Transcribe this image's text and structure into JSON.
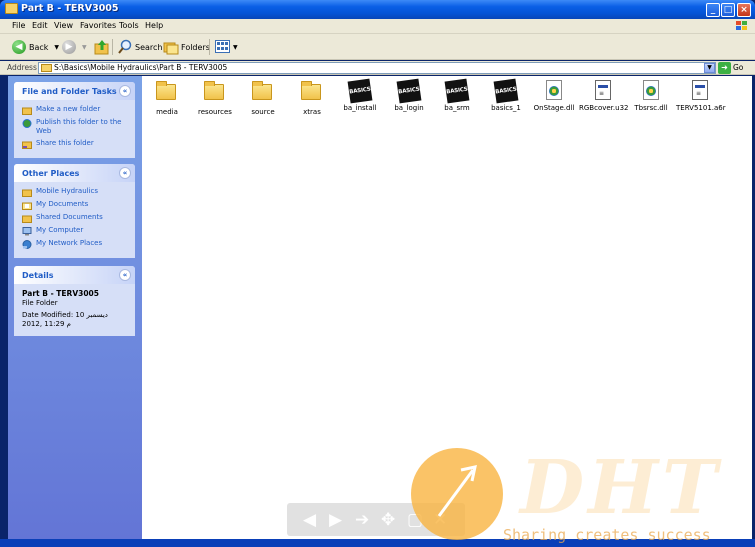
{
  "window": {
    "title": "Part B - TERV3005"
  },
  "menubar": {
    "items": [
      "File",
      "Edit",
      "View",
      "Favorites",
      "Tools",
      "Help"
    ]
  },
  "toolbar": {
    "back_label": "Back",
    "search_label": "Search",
    "folders_label": "Folders"
  },
  "address": {
    "label": "Address",
    "path": "S:\\Basics\\Mobile Hydraulics\\Part B - TERV3005",
    "go_label": "Go"
  },
  "tasks": {
    "title": "File and Folder Tasks",
    "items": [
      {
        "label": "Make a new folder",
        "icon": "new-folder-icon"
      },
      {
        "label": "Publish this folder to the Web",
        "icon": "publish-web-icon"
      },
      {
        "label": "Share this folder",
        "icon": "share-folder-icon"
      }
    ]
  },
  "places": {
    "title": "Other Places",
    "items": [
      {
        "label": "Mobile Hydraulics",
        "icon": "folder-icon"
      },
      {
        "label": "My Documents",
        "icon": "my-documents-icon"
      },
      {
        "label": "Shared Documents",
        "icon": "shared-documents-icon"
      },
      {
        "label": "My Computer",
        "icon": "my-computer-icon"
      },
      {
        "label": "My Network Places",
        "icon": "network-places-icon"
      }
    ]
  },
  "details": {
    "title": "Details",
    "name": "Part B - TERV3005",
    "type": "File Folder",
    "date_label": "Date Modified: 10 ديسمبر",
    "date_line2": "2012, 11:29 م"
  },
  "files": [
    {
      "name": "media",
      "kind": "folder"
    },
    {
      "name": "resources",
      "kind": "folder"
    },
    {
      "name": "source",
      "kind": "folder"
    },
    {
      "name": "xtras",
      "kind": "folder"
    },
    {
      "name": "ba_install",
      "kind": "basics"
    },
    {
      "name": "ba_login",
      "kind": "basics"
    },
    {
      "name": "ba_srm",
      "kind": "basics"
    },
    {
      "name": "basics_1",
      "kind": "basics"
    },
    {
      "name": "OnStage.dll",
      "kind": "dll"
    },
    {
      "name": "RGBcover.u32",
      "kind": "sys"
    },
    {
      "name": "Tbsrsc.dll",
      "kind": "dll"
    },
    {
      "name": "TERV5101.a6r",
      "kind": "sys"
    }
  ],
  "basics_icon_text": "BASICS",
  "watermark": {
    "logo": "DHT",
    "slogan": "Sharing creates success"
  },
  "colors": {
    "titlebar": "#0554d6",
    "taskpane": "#7ba2e7",
    "link": "#215dc6"
  }
}
